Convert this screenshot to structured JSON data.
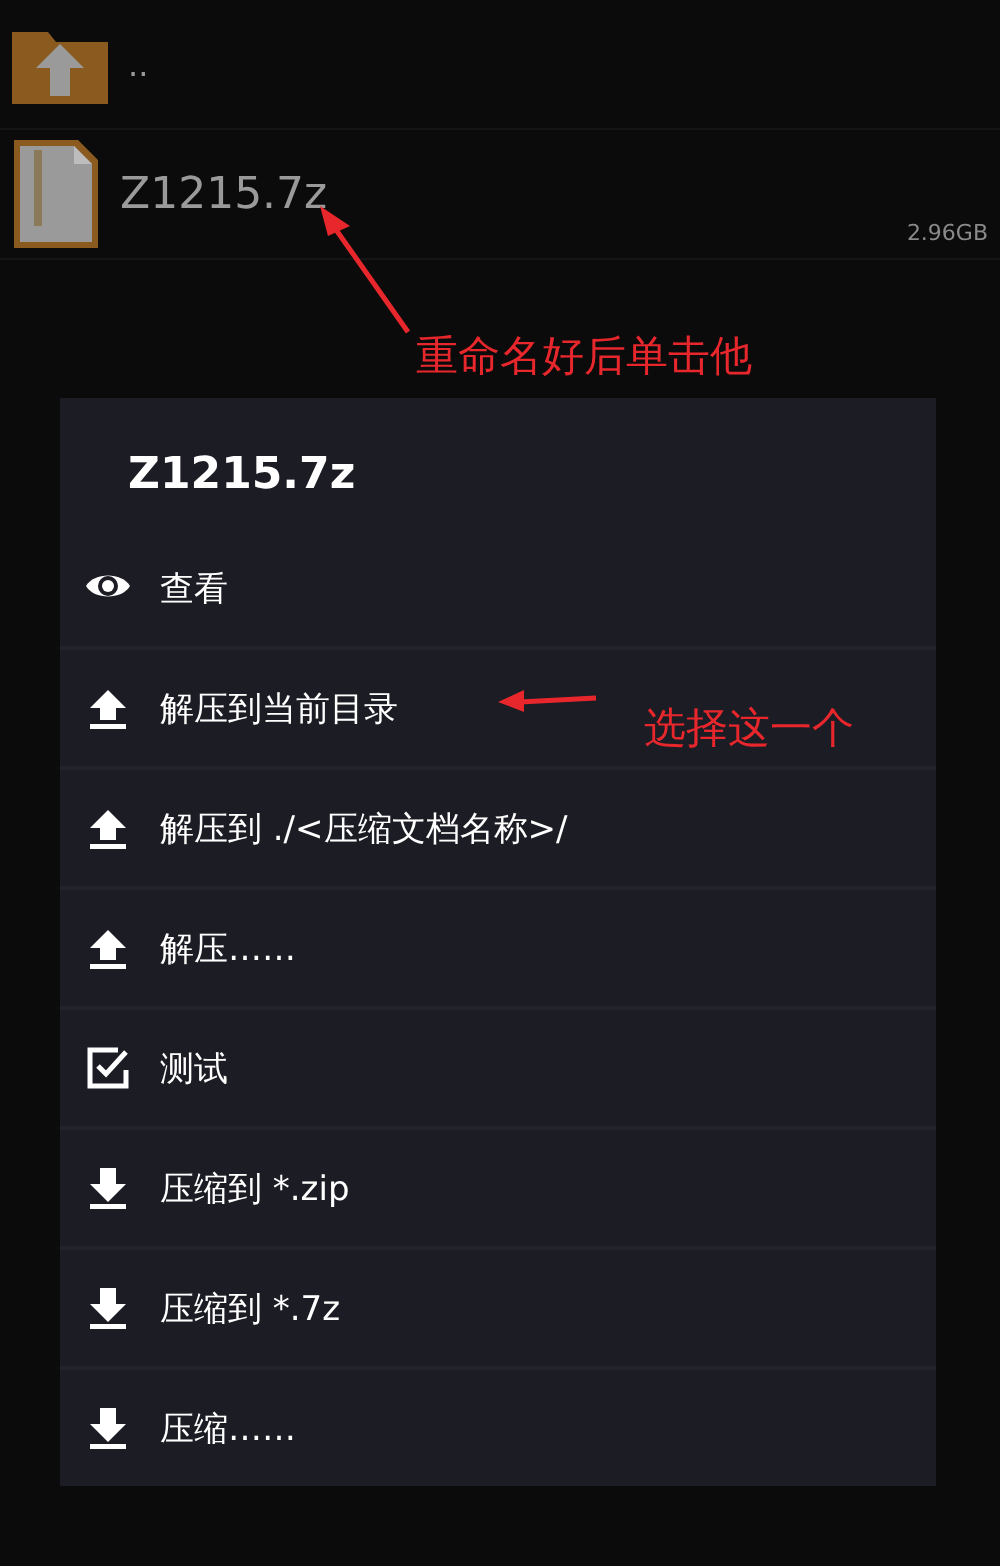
{
  "files": [
    {
      "kind": "parent",
      "name": ".."
    },
    {
      "kind": "archive",
      "name": "Z1215.7z",
      "size": "2.96GB"
    }
  ],
  "menu": {
    "title": "Z1215.7z",
    "items": [
      {
        "kind": "view",
        "label": "查看"
      },
      {
        "kind": "extract",
        "label": "解压到当前目录"
      },
      {
        "kind": "extract",
        "label": "解压到 ./<压缩文档名称>/"
      },
      {
        "kind": "extract",
        "label": "解压……"
      },
      {
        "kind": "test",
        "label": "测试"
      },
      {
        "kind": "compress",
        "label": "压缩到 *.zip"
      },
      {
        "kind": "compress",
        "label": "压缩到 *.7z"
      },
      {
        "kind": "compress",
        "label": "压缩……"
      }
    ]
  },
  "annotations": [
    {
      "kind": "note-top",
      "text": "重命名好后单击他"
    },
    {
      "kind": "note-menu",
      "text": "选择这一个"
    }
  ]
}
